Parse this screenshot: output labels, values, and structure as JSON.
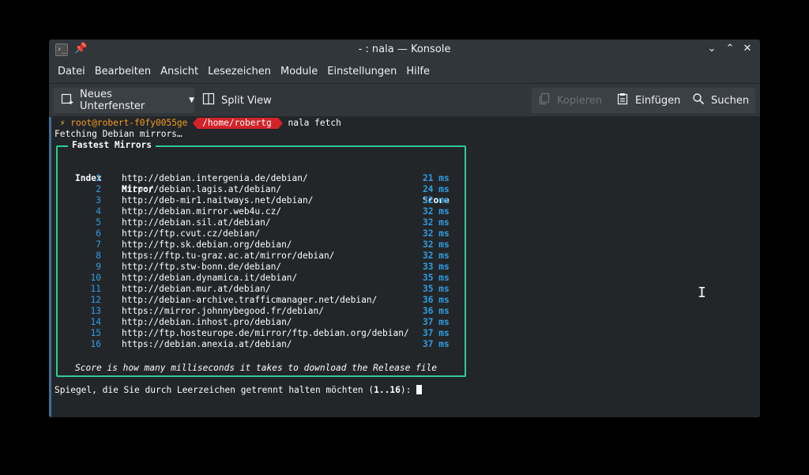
{
  "window": {
    "title": "- : nala — Konsole",
    "buttons": {
      "minimize": "⌄",
      "maximize": "⌃",
      "close": "✕"
    }
  },
  "menu": [
    "Datei",
    "Bearbeiten",
    "Ansicht",
    "Lesezeichen",
    "Module",
    "Einstellungen",
    "Hilfe"
  ],
  "toolbar": {
    "new_tab": "Neues Unterfenster",
    "split_view": "Split View",
    "copy": "Kopieren",
    "paste": "Einfügen",
    "search": "Suchen"
  },
  "terminal": {
    "prompt_user": "root@robert-f0fy0055ge",
    "prompt_path": "/home/robertg",
    "command": "nala fetch",
    "fetching": "Fetching Debian mirrors…",
    "box_title": "Fastest Mirrors",
    "headers": {
      "index": "Index",
      "mirror": "Mirror",
      "score": "Score"
    },
    "mirrors": [
      {
        "index": "1",
        "url": "http://debian.intergenia.de/debian/",
        "score": "21 ms"
      },
      {
        "index": "2",
        "url": "http://debian.lagis.at/debian/",
        "score": "24 ms"
      },
      {
        "index": "3",
        "url": "http://deb-mir1.naitways.net/debian/",
        "score": "32 ms"
      },
      {
        "index": "4",
        "url": "http://debian.mirror.web4u.cz/",
        "score": "32 ms"
      },
      {
        "index": "5",
        "url": "http://debian.sil.at/debian/",
        "score": "32 ms"
      },
      {
        "index": "6",
        "url": "http://ftp.cvut.cz/debian/",
        "score": "32 ms"
      },
      {
        "index": "7",
        "url": "http://ftp.sk.debian.org/debian/",
        "score": "32 ms"
      },
      {
        "index": "8",
        "url": "https://ftp.tu-graz.ac.at/mirror/debian/",
        "score": "32 ms"
      },
      {
        "index": "9",
        "url": "http://ftp.stw-bonn.de/debian/",
        "score": "33 ms"
      },
      {
        "index": "10",
        "url": "http://debian.dynamica.it/debian/",
        "score": "35 ms"
      },
      {
        "index": "11",
        "url": "http://debian.mur.at/debian/",
        "score": "35 ms"
      },
      {
        "index": "12",
        "url": "http://debian-archive.trafficmanager.net/debian/",
        "score": "36 ms"
      },
      {
        "index": "13",
        "url": "https://mirror.johnnybegood.fr/debian/",
        "score": "36 ms"
      },
      {
        "index": "14",
        "url": "http://debian.inhost.pro/debian/",
        "score": "37 ms"
      },
      {
        "index": "15",
        "url": "http://ftp.hosteurope.de/mirror/ftp.debian.org/debian/",
        "score": "37 ms"
      },
      {
        "index": "16",
        "url": "https://debian.anexia.at/debian/",
        "score": "37 ms"
      }
    ],
    "footnote": "Score is how many milliseconds it takes to download the Release file",
    "input_prompt_pre": "Spiegel, die Sie durch Leerzeichen getrennt halten möchten (",
    "input_prompt_range": "1..16",
    "input_prompt_post": "): "
  },
  "colors": {
    "accent_green": "#2ecc9a",
    "index_blue": "#2e9ee4",
    "prompt_red": "#d2232a",
    "prompt_orange": "#f39c1f"
  }
}
